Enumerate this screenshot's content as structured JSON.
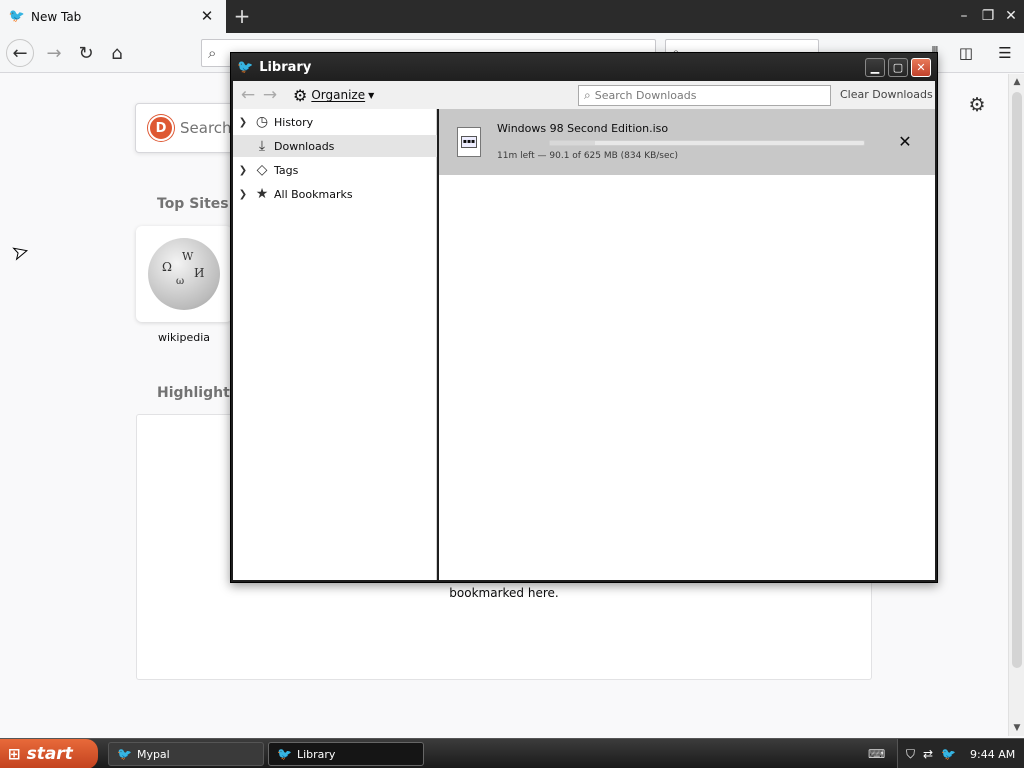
{
  "browser": {
    "tab_title": "New Tab",
    "new_tab_symbol": "+",
    "window_buttons": [
      "–",
      "❐",
      "✕"
    ]
  },
  "page": {
    "search_placeholder": "Search",
    "top_sites_title": "Top Sites",
    "top_sites": [
      {
        "label": "wikipedia"
      }
    ],
    "highlights_title": "Highlights",
    "highlights_message": "bookmarked here."
  },
  "library": {
    "title": "Library",
    "organize_label": "Organize",
    "search_placeholder": "Search Downloads",
    "clear_downloads_label": "Clear Downloads",
    "tree": [
      {
        "label": "History",
        "icon": "clock-icon",
        "expandable": true
      },
      {
        "label": "Downloads",
        "icon": "download-arrow-icon",
        "expandable": false,
        "selected": true
      },
      {
        "label": "Tags",
        "icon": "tag-icon",
        "expandable": true
      },
      {
        "label": "All Bookmarks",
        "icon": "star-icon",
        "expandable": true
      }
    ],
    "downloads": [
      {
        "filename": "Windows 98 Second Edition.iso",
        "status": "11m left — 90.1 of 625 MB (834 KB/sec)",
        "progress_fraction": 0.144
      }
    ]
  },
  "taskbar": {
    "start_label": "start",
    "tasks": [
      {
        "label": "Mypal",
        "active": false
      },
      {
        "label": "Library",
        "active": true
      }
    ],
    "clock": "9:44 AM"
  },
  "colors": {
    "start_button": "#c2411e",
    "ddg_orange": "#de5833",
    "download_row_bg": "#c8c8c8"
  }
}
